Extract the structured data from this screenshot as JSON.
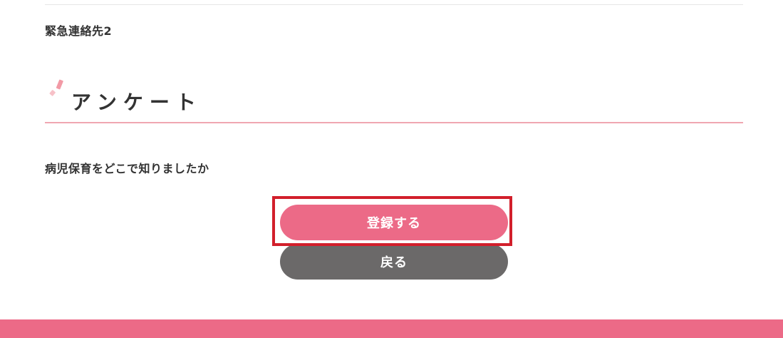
{
  "form": {
    "emergency_contact_label": "緊急連絡先2"
  },
  "survey": {
    "heading": "アンケート",
    "question": "病児保育をどこで知りましたか"
  },
  "actions": {
    "register_label": "登録する",
    "back_label": "戻る"
  },
  "colors": {
    "accent_pink": "#ec6a87",
    "heading_underline": "#f0a7b1",
    "back_button_gray": "#6b6969",
    "highlight_red": "#d21f2b"
  }
}
